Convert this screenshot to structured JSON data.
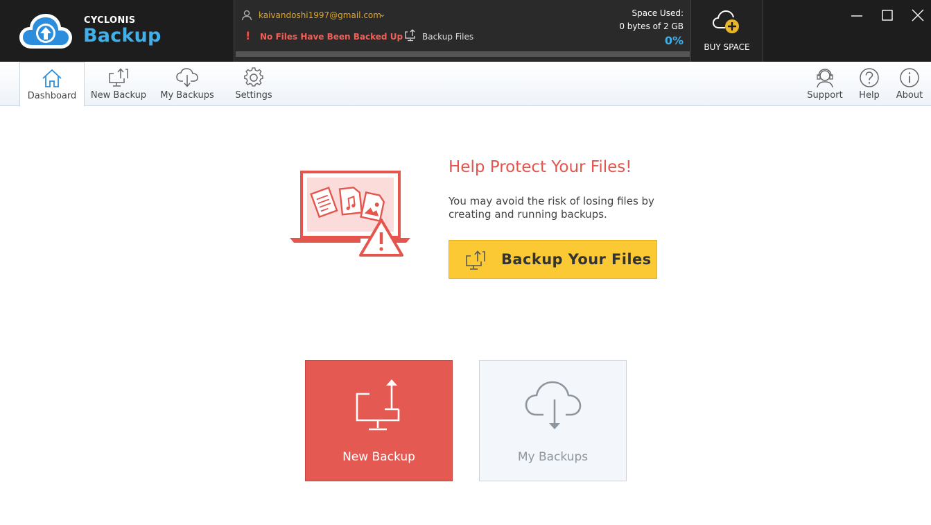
{
  "app": {
    "brand_small": "CYCLONIS",
    "brand_big": "Backup"
  },
  "account": {
    "email": "kaivandoshi1997@gmail.com",
    "chevron": "⌄",
    "warning_icon": "!",
    "warning": "No Files Have Been Backed Up",
    "backup_files": "Backup Files",
    "space_label": "Space Used:",
    "space_value": "0 bytes of 2 GB",
    "space_percent": "0%",
    "progress": 0
  },
  "buy_space": {
    "label": "BUY SPACE"
  },
  "toolbar": {
    "dashboard": "Dashboard",
    "new_backup": "New Backup",
    "my_backups": "My Backups",
    "settings": "Settings",
    "support": "Support",
    "help": "Help",
    "about": "About",
    "active": "Dashboard"
  },
  "hero": {
    "title": "Help Protect Your Files!",
    "text": "You may avoid the risk of losing files by creating and running backups.",
    "cta": "Backup Your Files"
  },
  "tiles": {
    "new_backup": "New Backup",
    "my_backups": "My Backups"
  },
  "colors": {
    "accent_blue": "#3fb0ea",
    "warning_red": "#e4554d",
    "cta_yellow": "#fbc933",
    "email_orange": "#e0a628"
  },
  "icons": {
    "logo": "cloud-upload-icon",
    "user": "user-icon",
    "buy_space": "cloud-plus-icon",
    "dashboard": "home-icon",
    "new_backup": "monitor-upload-icon",
    "my_backups": "cloud-download-icon",
    "settings": "gear-icon",
    "support": "headset-icon",
    "help": "question-icon",
    "about": "info-icon"
  }
}
